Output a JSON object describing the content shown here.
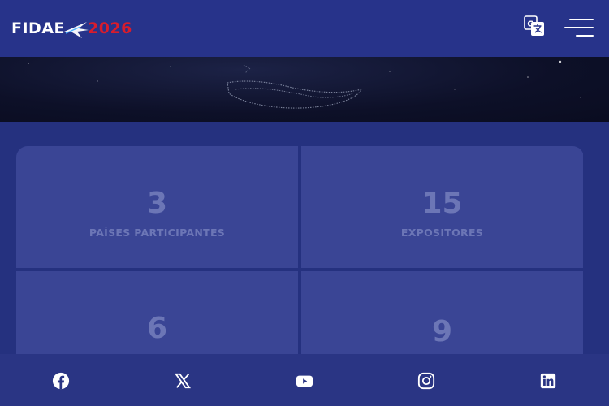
{
  "header": {
    "logo": {
      "text_left": "FIDAE",
      "text_right": "2026"
    },
    "translate_icon": "google-translate-icon",
    "menu_icon": "hamburger-menu-icon"
  },
  "stats": [
    {
      "value": "3",
      "label": "PAÍSES PARTICIPANTES"
    },
    {
      "value": "15",
      "label": "EXPOSITORES"
    },
    {
      "value": "6",
      "label": ""
    },
    {
      "value": "9",
      "label": ""
    }
  ],
  "social": [
    {
      "icon": "facebook-icon"
    },
    {
      "icon": "x-twitter-icon"
    },
    {
      "icon": "youtube-icon"
    },
    {
      "icon": "instagram-icon"
    },
    {
      "icon": "linkedin-icon"
    }
  ],
  "colors": {
    "header_bg": "#27338a",
    "page_bg": "#25317f",
    "card_bg": "#3a4595",
    "stat_text": "#6c76b6",
    "logo_red": "#d81c2c",
    "social_bar_bg": "#2a3584"
  }
}
